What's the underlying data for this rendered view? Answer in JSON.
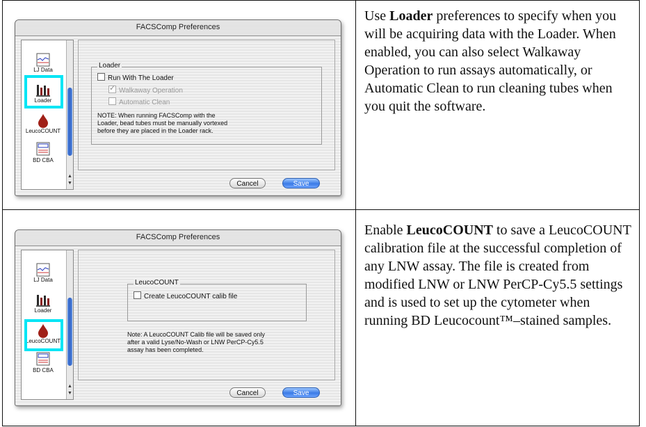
{
  "row1": {
    "window_title": "FACSComp Preferences",
    "sidebar": [
      "LJ Data",
      "Loader",
      "LeucoCOUNT",
      "BD CBA"
    ],
    "group_title": "Loader",
    "check1": "Run With The Loader",
    "check2": "Walkaway Operation",
    "check3": "Automatic Clean",
    "note": [
      "NOTE:  When running FACSComp with the",
      "Loader, bead tubes must be manually vortexed",
      "before they are placed in the Loader rack."
    ],
    "cancel": "Cancel",
    "save": "Save",
    "desc_pre": "Use ",
    "desc_bold": "Loader",
    "desc_post": " preferences to specify when you will be acquiring data with the Loader. When enabled, you can also select Walkaway Operation to run assays automatically, or Automatic Clean to run cleaning tubes when you quit the software."
  },
  "row2": {
    "window_title": "FACSComp Preferences",
    "sidebar": [
      "LJ Data",
      "Loader",
      "LeucoCOUNT",
      "BD CBA"
    ],
    "group_title": "LeucoCOUNT",
    "check1": "Create LeucoCOUNT calib file",
    "note": [
      "Note: A LeucoCOUNT Calib file will be saved only",
      "after a valid Lyse/No-Wash or LNW PerCP-Cy5.5",
      "assay has been completed."
    ],
    "cancel": "Cancel",
    "save": "Save",
    "desc_pre": "Enable ",
    "desc_bold": "LeucoCOUNT",
    "desc_post": " to save a LeucoCOUNT calibration file at the successful completion of any LNW assay. The file is created from modified LNW or LNW PerCP-Cy5.5 settings and is used to set up the cytometer when running BD Leucocount™–stained samples."
  }
}
